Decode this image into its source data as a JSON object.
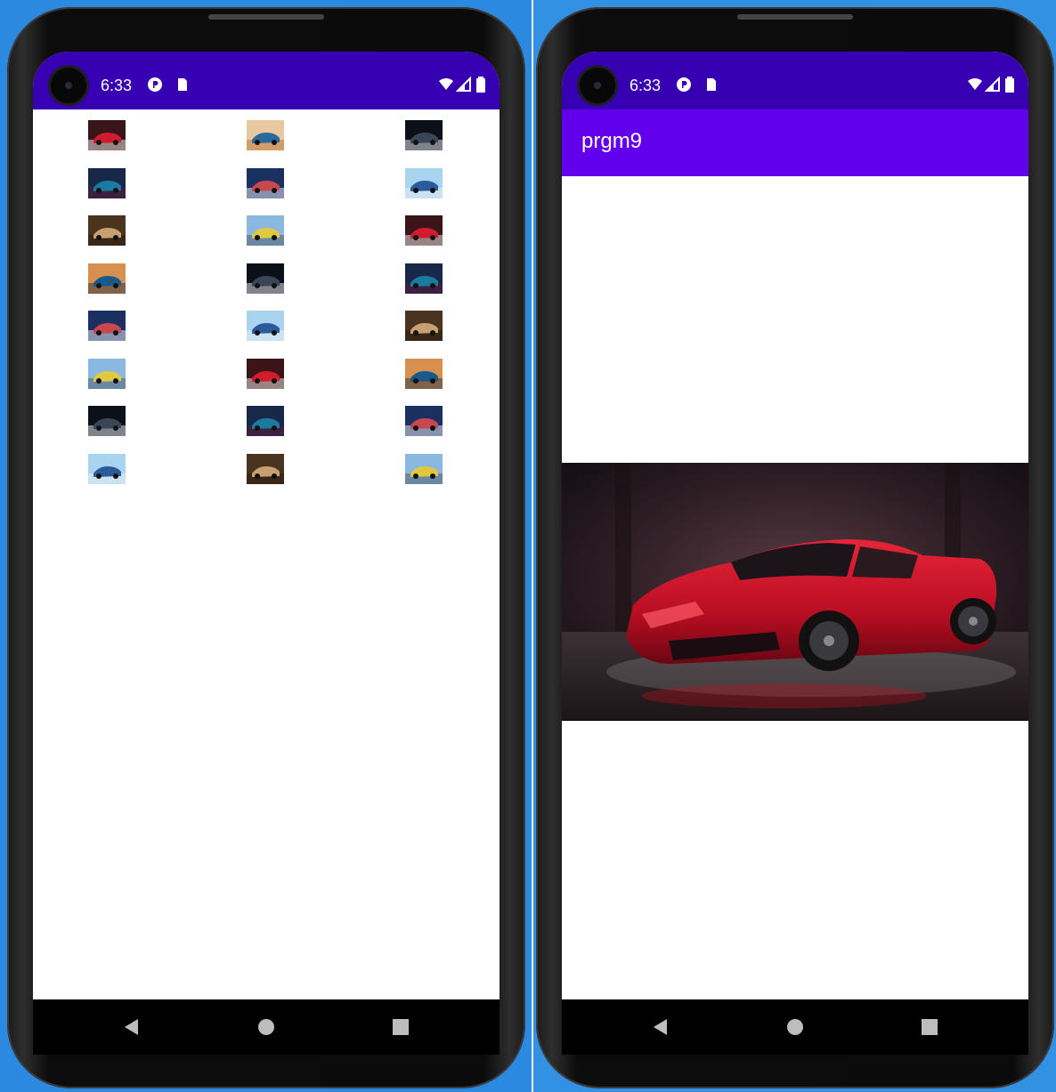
{
  "left_phone": {
    "status": {
      "time": "6:33"
    },
    "thumbnails": [
      {
        "scheme": "red"
      },
      {
        "scheme": "orange"
      },
      {
        "scheme": "dark"
      },
      {
        "scheme": "blue-dark"
      },
      {
        "scheme": "blue-mix"
      },
      {
        "scheme": "sky"
      },
      {
        "scheme": "brown"
      },
      {
        "scheme": "sky-yellow"
      },
      {
        "scheme": "red"
      },
      {
        "scheme": "orange-blue"
      },
      {
        "scheme": "dark"
      },
      {
        "scheme": "blue-dark"
      },
      {
        "scheme": "blue-mix"
      },
      {
        "scheme": "sky"
      },
      {
        "scheme": "brown"
      },
      {
        "scheme": "sky-yellow"
      },
      {
        "scheme": "red"
      },
      {
        "scheme": "orange-blue"
      },
      {
        "scheme": "dark"
      },
      {
        "scheme": "blue-dark"
      },
      {
        "scheme": "blue-mix"
      },
      {
        "scheme": "sky"
      },
      {
        "scheme": "brown"
      },
      {
        "scheme": "sky-yellow"
      }
    ]
  },
  "right_phone": {
    "status": {
      "time": "6:33"
    },
    "appbar": {
      "title": "prgm9"
    },
    "image": {
      "subject": "red-sports-car"
    }
  },
  "colors": {
    "status_bar": "#3700b3",
    "app_bar": "#6200ee",
    "background": "#2f8fe0"
  },
  "icons": {
    "back": "back-triangle-icon",
    "home": "home-circle-icon",
    "recents": "recents-square-icon"
  }
}
